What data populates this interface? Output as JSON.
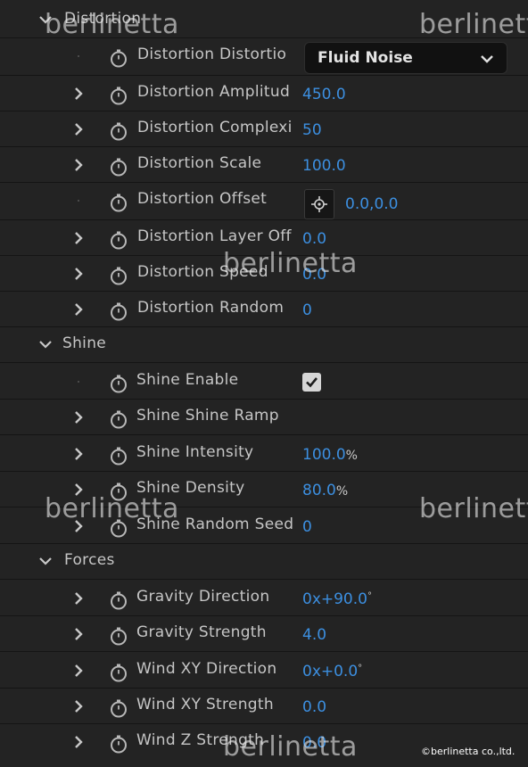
{
  "groups": {
    "distortion": "Distortion",
    "shine": "Shine",
    "forces": "Forces"
  },
  "properties": {
    "distortion_type": {
      "label": "Distortion Distortio",
      "value": "Fluid Noise"
    },
    "distortion_amplitude": {
      "label": "Distortion Amplitud",
      "value": "450.0"
    },
    "distortion_complexity": {
      "label": "Distortion Complexi",
      "value": "50"
    },
    "distortion_scale": {
      "label": "Distortion Scale",
      "value": "100.0"
    },
    "distortion_offset": {
      "label": "Distortion Offset",
      "value": "0.0,0.0"
    },
    "distortion_layer_offset": {
      "label": "Distortion Layer Off",
      "value": "0.0"
    },
    "distortion_speed": {
      "label": "Distortion Speed",
      "value": "0.0"
    },
    "distortion_random": {
      "label": "Distortion Random",
      "value": "0"
    },
    "shine_enable": {
      "label": "Shine Enable",
      "checked": true
    },
    "shine_ramp": {
      "label": "Shine Shine Ramp"
    },
    "shine_intensity": {
      "label": "Shine Intensity",
      "value": "100.0",
      "unit": "%"
    },
    "shine_density": {
      "label": "Shine Density",
      "value": "80.0",
      "unit": "%"
    },
    "shine_random_seed": {
      "label": "Shine Random Seed",
      "value": "0"
    },
    "gravity_direction": {
      "label": "Gravity Direction",
      "value": "0x+90.0",
      "unit": "°"
    },
    "gravity_strength": {
      "label": "Gravity Strength",
      "value": "4.0"
    },
    "wind_xy_direction": {
      "label": "Wind XY Direction",
      "value": "0x+0.0",
      "unit": "°"
    },
    "wind_xy_strength": {
      "label": "Wind XY Strength",
      "value": "0.0"
    },
    "wind_z_strength": {
      "label": "Wind Z Strength",
      "value": "0.0"
    }
  },
  "watermark": "berlinetta",
  "copyright": "©berlinetta co.,ltd.",
  "colors": {
    "panel_bg": "#232323",
    "row_divider": "#141414",
    "value_blue": "#3c8fe0",
    "label_gray": "#c6c6c6"
  }
}
